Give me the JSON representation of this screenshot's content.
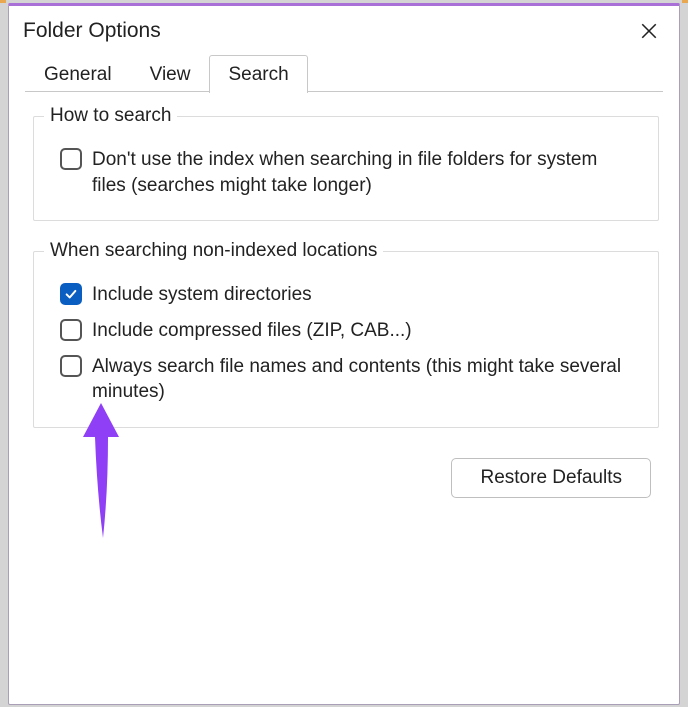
{
  "window": {
    "title": "Folder Options"
  },
  "tabs": {
    "items": [
      {
        "label": "General"
      },
      {
        "label": "View"
      },
      {
        "label": "Search"
      }
    ],
    "active_index": 2
  },
  "group_how": {
    "legend": "How to search",
    "options": [
      {
        "label": "Don't use the index when searching in file folders for system files (searches might take longer)",
        "checked": false,
        "name": "dont-use-index"
      }
    ]
  },
  "group_nonindexed": {
    "legend": "When searching non-indexed locations",
    "options": [
      {
        "label": "Include system directories",
        "checked": true,
        "name": "include-system-dirs"
      },
      {
        "label": "Include compressed files (ZIP, CAB...)",
        "checked": false,
        "name": "include-compressed"
      },
      {
        "label": "Always search file names and contents (this might take several minutes)",
        "checked": false,
        "name": "always-search-contents"
      }
    ]
  },
  "buttons": {
    "restore_defaults": "Restore Defaults"
  },
  "annotation": {
    "color": "#8f3ff5"
  }
}
